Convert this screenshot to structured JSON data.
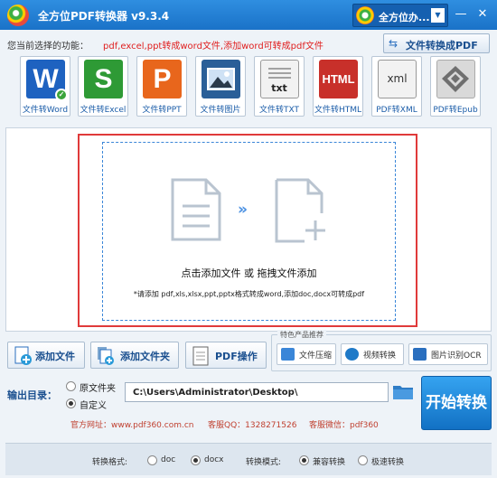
{
  "window": {
    "title": "全方位PDF转换器 v9.3.4",
    "product_switch": "全方位办...",
    "min_symbol": "—",
    "close_symbol": "✕"
  },
  "selection": {
    "label": "您当前选择的功能：",
    "description": "pdf,excel,ppt转成word文件,添加word可转成pdf文件"
  },
  "mode_button": {
    "label": "文件转换成PDF",
    "icon": "swap-arrows-icon"
  },
  "functions": [
    {
      "label": "文件转Word",
      "glyph": "W",
      "color": "#1e62c0",
      "selected": true
    },
    {
      "label": "文件转Excel",
      "glyph": "S",
      "color": "#2e9a35",
      "selected": false
    },
    {
      "label": "文件转PPT",
      "glyph": "P",
      "color": "#e8661c",
      "selected": false
    },
    {
      "label": "文件转图片",
      "glyph": "🖼",
      "color": "#2a5f98",
      "selected": false
    },
    {
      "label": "文件转TXT",
      "glyph": "txt",
      "color": "#f2f2f2",
      "selected": false
    },
    {
      "label": "文件转HTML",
      "glyph": "HTML",
      "color": "#c8302a",
      "selected": false
    },
    {
      "label": "PDF转XML",
      "glyph": "xml",
      "color": "#f2f2f2",
      "selected": false
    },
    {
      "label": "PDF转Epub",
      "glyph": "◈",
      "color": "#6f6f6f",
      "selected": false
    }
  ],
  "drop_zone": {
    "title": "点击添加文件  或  拖拽文件添加",
    "hint": "*请添加 pdf,xls,xlsx,ppt,pptx格式转成word,添加doc,docx可转成pdf",
    "arrows": "»"
  },
  "toolbar": {
    "add_file": "添加文件",
    "add_folder": "添加文件夹",
    "pdf_ops": "PDF操作"
  },
  "featured": {
    "title": "特色产品推荐",
    "items": [
      "文件压缩",
      "视频转换",
      "图片识别OCR"
    ]
  },
  "output": {
    "label": "输出目录：",
    "option_source": "原文件夹",
    "option_custom": "自定义",
    "selected": "custom",
    "path": "C:\\Users\\Administrator\\Desktop\\"
  },
  "start_button": "开始转换",
  "contact": {
    "website": "官方网址：www.pdf360.com.cn",
    "qq": "客服QQ：1328271526",
    "wechat": "客服微信：pdf360"
  },
  "bottom": {
    "format_label": "转换格式:",
    "format_doc": "doc",
    "format_docx": "docx",
    "format_selected": "docx",
    "mode_label": "转换模式:",
    "mode_compat": "兼容转换",
    "mode_fast": "极速转换",
    "mode_selected": "compat"
  },
  "colors": {
    "accent": "#1a72c8",
    "highlight_red": "#e03a3a",
    "link_red": "#e02020"
  }
}
